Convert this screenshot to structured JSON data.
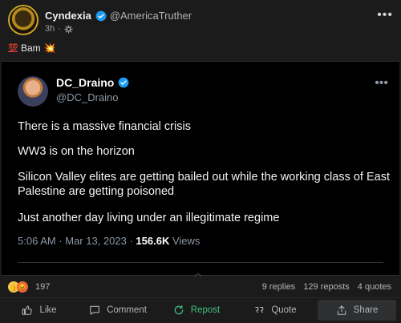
{
  "post": {
    "author_name": "Cyndexia",
    "author_handle": "@AmericaTruther",
    "time_ago": "3h",
    "caption_emoji_prefix": "💯",
    "caption_text": "Bam",
    "caption_emoji_suffix": "💥"
  },
  "embedded_tweet": {
    "name": "DC_Draino",
    "handle": "@DC_Draino",
    "lines": [
      "There is a massive financial crisis",
      "WW3 is on the horizon",
      "Silicon Valley elites are getting bailed out while the working class of East Palestine are getting poisoned",
      "Just another day living under an illegitimate regime"
    ],
    "timestamp": "5:06 AM · Mar 13, 2023 · ",
    "views_count": "156.6K",
    "views_label": " Views"
  },
  "engagement": {
    "reaction_count": "197",
    "replies": "9 replies",
    "reposts": "129 reposts",
    "quotes": "4 quotes"
  },
  "actions": {
    "like": "Like",
    "comment": "Comment",
    "repost": "Repost",
    "quote": "Quote",
    "share": "Share"
  },
  "colors": {
    "verified": "#1d9bf0",
    "repost_active": "#3fbf7f",
    "background": "#1b1b1b"
  }
}
